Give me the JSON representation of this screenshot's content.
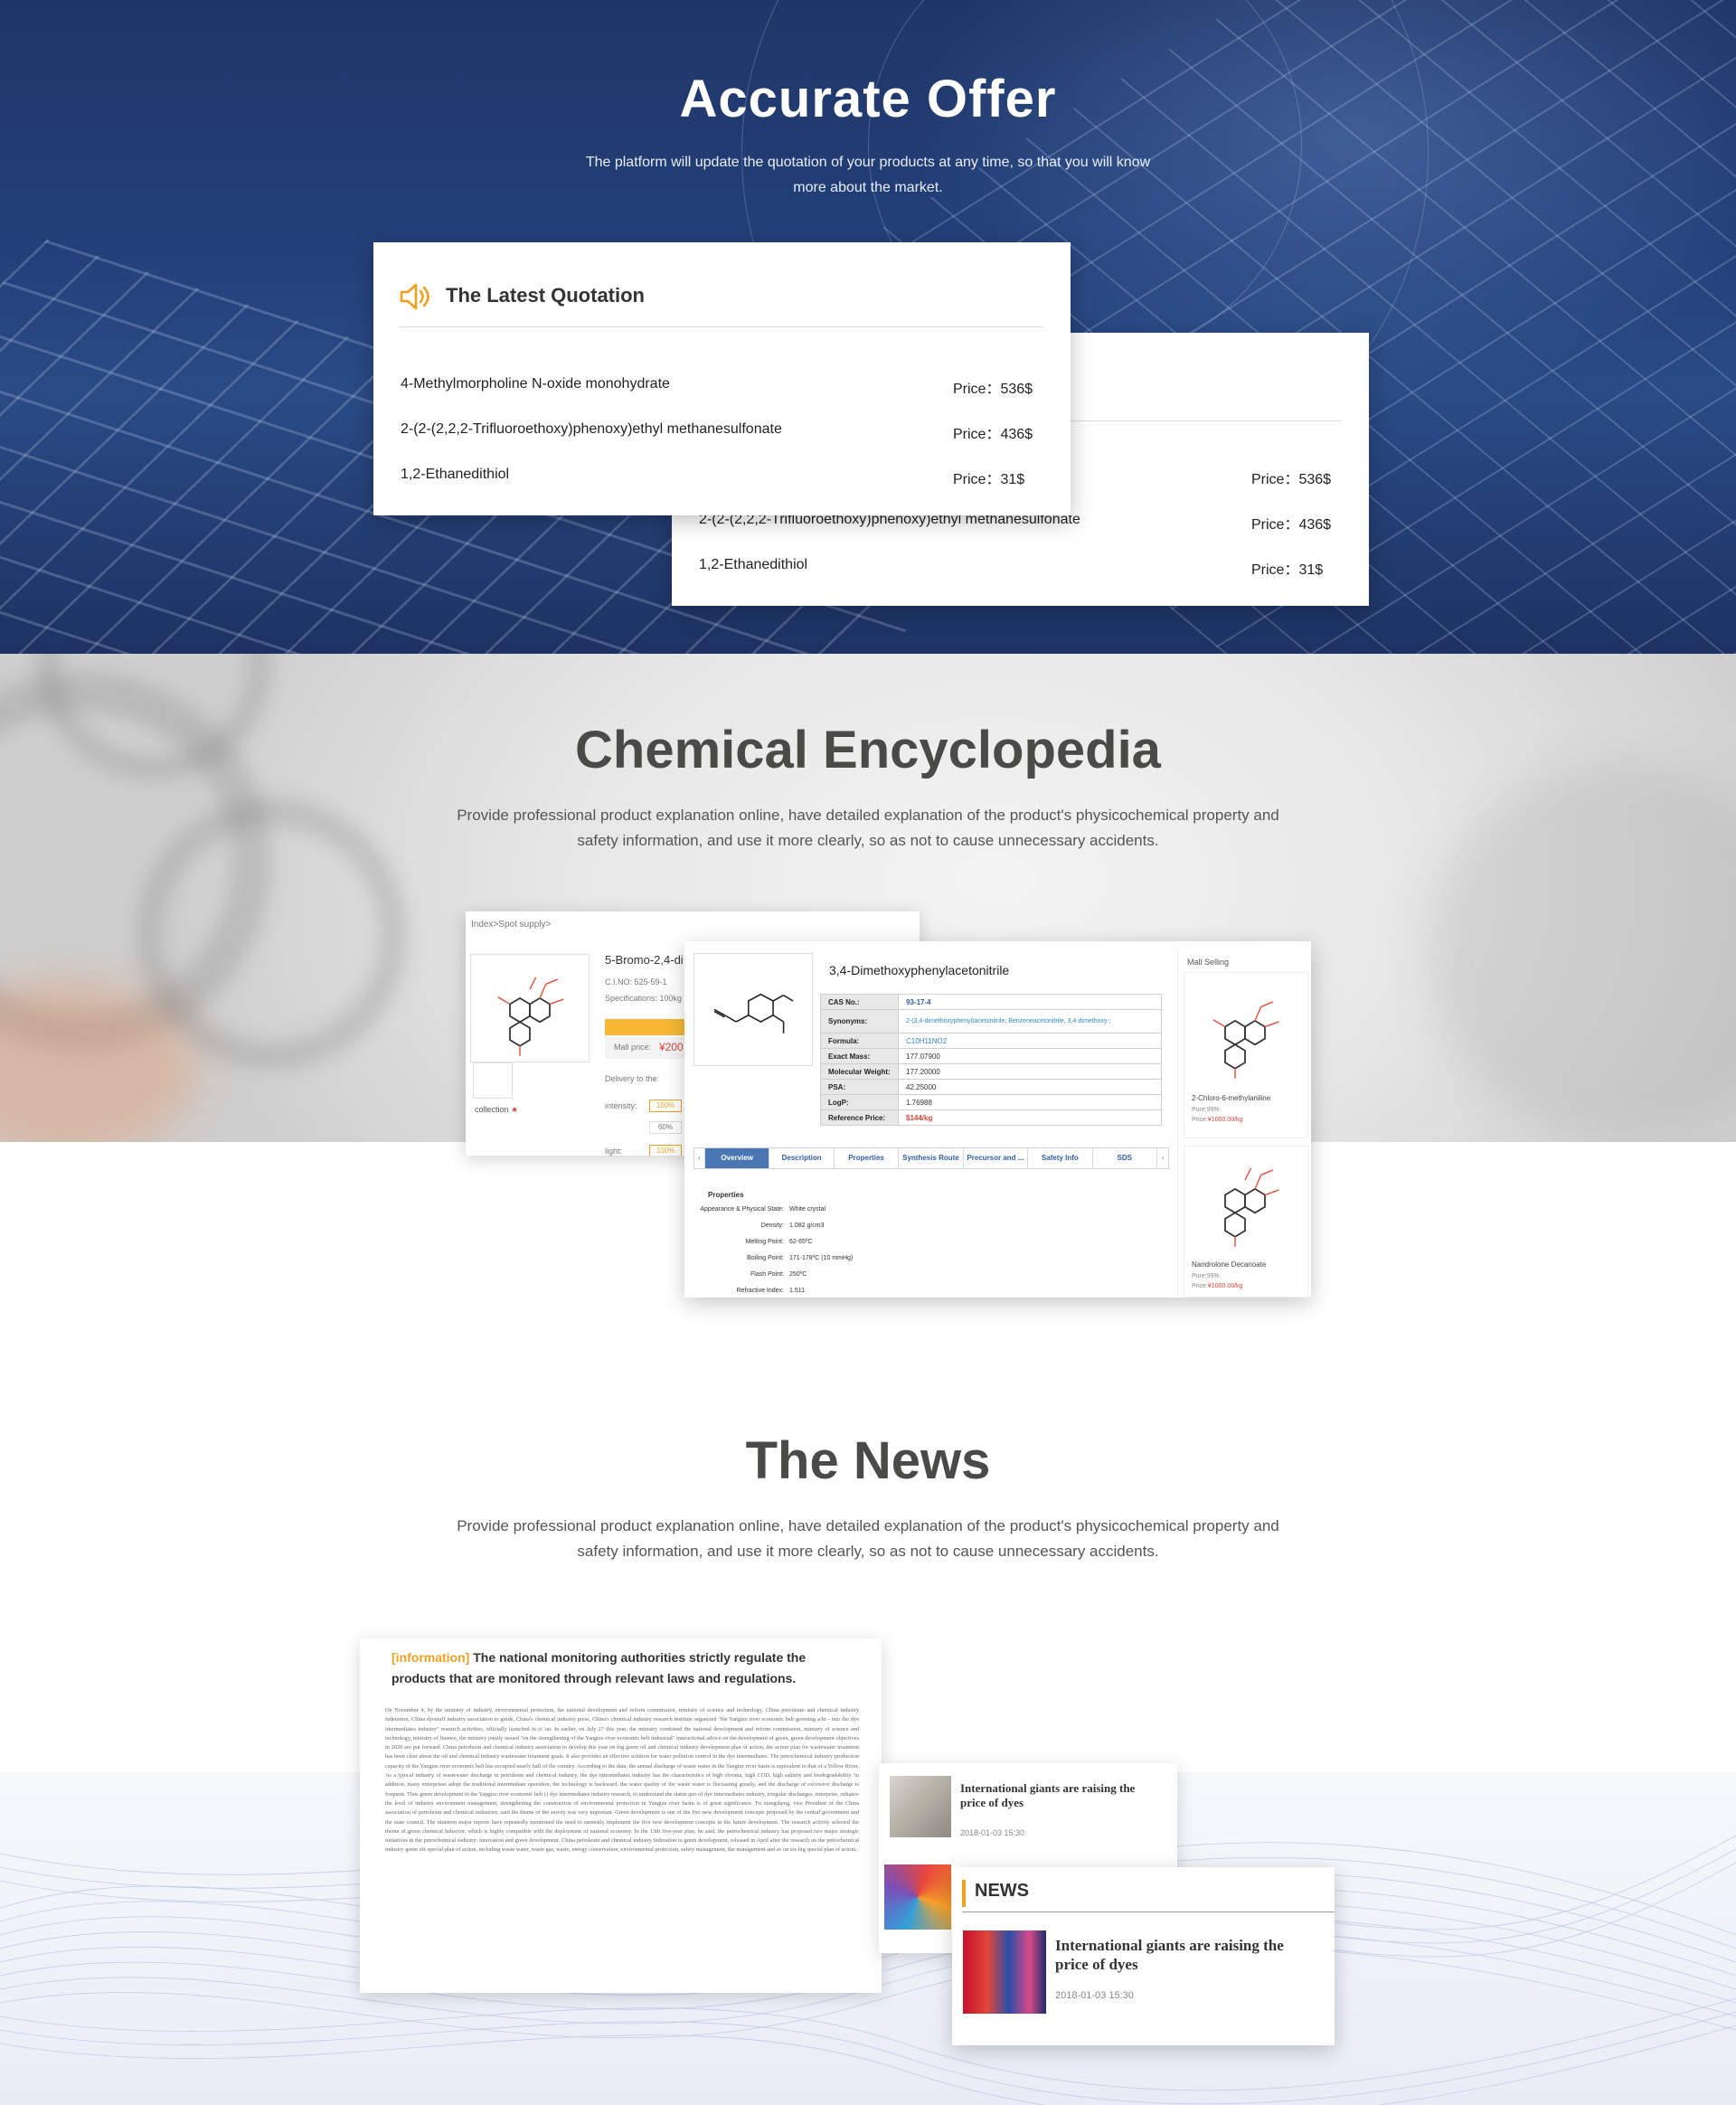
{
  "offer": {
    "title": "Accurate Offer",
    "subtitle": "The platform will update the quotation of your products at any time, so that you will know more about the market.",
    "card_title": "The Latest Quotation",
    "quotes": [
      {
        "name": "4-Methylmorpholine N-oxide monohydrate",
        "price": "Price：536$"
      },
      {
        "name": "2-(2-(2,2,2-Trifluoroethoxy)phenoxy)ethyl methanesulfonate",
        "price": "Price：436$"
      },
      {
        "name": "1,2-Ethanedithiol",
        "price": "Price：31$"
      }
    ]
  },
  "encyclopedia": {
    "title": "Chemical Encyclopedia",
    "subtitle": "Provide professional product explanation online, have detailed explanation of the product's physicochemical property and safety information, and use it more clearly, so as not to cause unnecessary accidents.",
    "shot_back": {
      "breadcrumb": "Index>Spot supply>",
      "product_name": "5-Bromo-2,4-di",
      "cas": "C.I.NO:  525-59-1",
      "spec": "Specifications: 100kg",
      "mall_price_label": "Mall price:",
      "mall_price": "¥200",
      "delivery": "Delivery to the:",
      "collection": "collection",
      "intensity_label": "intensity:",
      "intensity_value": "100%",
      "mid_value": "60%",
      "light_label": "light:",
      "light_value": "100%"
    },
    "shot_front": {
      "product_title": "3,4-Dimethoxyphenylacetonitrile",
      "table": [
        {
          "key": "CAS No.:",
          "value": "93-17-4"
        },
        {
          "key": "Synonyms:",
          "value": "2-(3,4-dimethoxyphenyl)acetonitrile; Benzeneacetonitrile, 3,4-dimethoxy-;"
        },
        {
          "key": "Formula:",
          "value": "C10H11NO2"
        },
        {
          "key": "Exact Mass:",
          "value": "177.07900"
        },
        {
          "key": "Molecular Weight:",
          "value": "177.20000"
        },
        {
          "key": "PSA:",
          "value": "42.25000"
        },
        {
          "key": "LogP:",
          "value": "1.76988"
        },
        {
          "key": "Reference Price:",
          "value": "$144/kg"
        }
      ],
      "tabs": [
        "Overview",
        "Description",
        "Properties",
        "Synthesis Route",
        "Precursor and ...",
        "Safety Info",
        "SDS"
      ],
      "properties_heading": "Properties",
      "properties": [
        {
          "key": "Appearance & Physical State:",
          "value": "White crystal"
        },
        {
          "key": "Density:",
          "value": "1.082 g/cm3"
        },
        {
          "key": "Melting Point:",
          "value": "62-65ºC"
        },
        {
          "key": "Boiling Point:",
          "value": "171-178ºC (10 mmHg)"
        },
        {
          "key": "Flash Point:",
          "value": "250ºC"
        },
        {
          "key": "Refractive Index:",
          "value": "1.511"
        }
      ],
      "mall_heading": "Mall Selling",
      "mall_items": [
        {
          "name": "2-Chloro-6-methylaniline",
          "purity": "Pure:99%",
          "price_label": "Price:",
          "price": "¥1000.00/kg"
        },
        {
          "name": "Nandrolone Decanoate",
          "purity": "Pure:99%",
          "price_label": "Price:",
          "price": "¥1000.00/kg"
        }
      ]
    }
  },
  "news": {
    "title": "The News",
    "subtitle": "Provide professional product explanation online, have detailed explanation of the product's physicochemical property and safety information, and use it more clearly, so as not to cause unnecessary accidents.",
    "article": {
      "tag": "[information]",
      "headline": " The national monitoring authorities strictly regulate the products that are monitored through relevant laws and regulations.",
      "body": "On November 4, by the ministry of industry, environmental protection, the national development and reform commission, ministry of science and technology, China petroleum and chemical industry federation, China dyestuff industry association to guide, China's chemical industry press, China's chemical industry research institute organized \"the Yangtze river economic belt greening a/hr - into the dye intermediates industry\" research activities, officially launched in zi 'an. In earlier, on July 27 this year, the ministry combined the national development and reform commission, ministry of science and technology, ministry of finance, the ministry jointly issued \"on the strengthening of the Yangtze river economic belt industrial\" instructional advice on the development of green, green development objectives in 2020 are put forward. China petroleum and chemical industry association to develop this year on big green oil and chemical industry development plan of action, the action plan for wastewater treatment has been clear about the oil and chemical industry wastewater treatment goals. It also provides an effective solution for water pollution control in the dye intermediates. The petrochemical industry production capacity of the Yangtze river economic belt has occupied nearly half of the country. According to the data, the annual discharge of waste water in the Yangtze river basin is equivalent to that of a Yellow River. As a typical industry of wastewater discharge in petroleum and chemical industry, the dye intermediates industry has the characteristics of high chroma, high COD, high salinity and biodegradability. In addition, many enterprises adopt the traditional intermediate operation, the technology is backward, the water quality of the waste water is fluctuating greatly, and the discharge of excessive discharge is frequent. Thus green development in the Yangtze river economic belt () dye intermediates industry research, to understand the status quo of dye intermediates industry, irregular discharges, enterprise, enhance the level of industry environment management, strengthening the construction of environmental protection in Yangtze river basin is of great significance. Fu xiangsheng, vice President of the China association of petroleum and chemical industries, said the theme of the survey was very important. Green development is one of the five new development concepts proposed by the central government and the state council. The nineteen major reports have repeatedly mentioned the need to earnestly implement the five new development concepts in the future development. The research activity selected the theme of green chemical behavior, which is highly compatible with the deployment of national economy. In the 13th five-year plan, he said, the petrochemical industry has proposed two major strategic initiatives in the petrochemical industry: innovation and green development. China petroleum and chemical industry federation to green development, released in April after the research on the petrochemical industry green six special plan of action, including waste water, waste gas, waste, energy conservation, environmental protection, safety management, the management and so on six big special plan of action."
    },
    "small_item": {
      "title": "International giants are raising the price of dyes",
      "date": "2018-01-03  15:30"
    },
    "news_card": {
      "heading": "NEWS",
      "title": "International giants are raising the price of dyes",
      "date": "2018-01-03  15:30"
    }
  },
  "colors": {
    "accent": "#f0a021",
    "hero_blue": "#23407a",
    "price_red": "#e0453a",
    "link_blue": "#2e5ea8"
  }
}
